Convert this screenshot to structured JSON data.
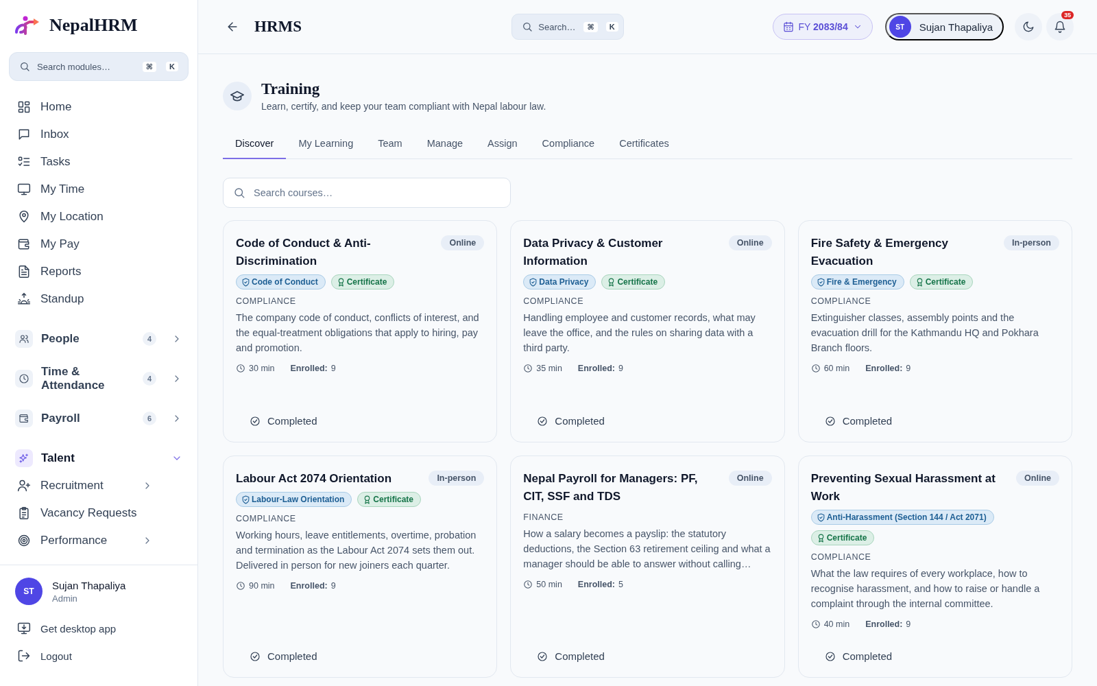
{
  "brand": {
    "name": "NepalHRM"
  },
  "sidebar": {
    "search": {
      "placeholder": "Search modules…",
      "keys": [
        "⌘",
        "K"
      ]
    },
    "items": [
      {
        "label": "Home"
      },
      {
        "label": "Inbox"
      },
      {
        "label": "Tasks"
      },
      {
        "label": "My Time"
      },
      {
        "label": "My Location"
      },
      {
        "label": "My Pay"
      },
      {
        "label": "Reports"
      },
      {
        "label": "Standup"
      }
    ],
    "groups": [
      {
        "label": "People",
        "count": "4",
        "expanded": false
      },
      {
        "label": "Time & Attendance",
        "count": "4",
        "expanded": false
      },
      {
        "label": "Payroll",
        "count": "6",
        "expanded": false
      },
      {
        "label": "Talent",
        "expanded": true,
        "children": [
          {
            "label": "Recruitment",
            "expanded": false
          },
          {
            "label": "Vacancy Requests"
          },
          {
            "label": "Performance",
            "expanded": false
          }
        ]
      }
    ],
    "user": {
      "initials": "ST",
      "name": "Sujan Thapaliya",
      "role": "Admin"
    },
    "footer": [
      {
        "label": "Get desktop app"
      },
      {
        "label": "Logout"
      }
    ]
  },
  "header": {
    "title": "HRMS",
    "search": {
      "placeholder": "Search…",
      "keys": [
        "⌘",
        "K"
      ]
    },
    "fiscal_year": {
      "prefix": "FY",
      "value": "2083/84"
    },
    "user": {
      "initials": "ST",
      "name": "Sujan Thapaliya"
    },
    "notifications": "35"
  },
  "page": {
    "title": "Training",
    "subtitle": "Learn, certify, and keep your team compliant with Nepal labour law."
  },
  "tabs": [
    {
      "label": "Discover",
      "selected": true
    },
    {
      "label": "My Learning",
      "selected": false
    },
    {
      "label": "Team",
      "selected": false
    },
    {
      "label": "Manage",
      "selected": false
    },
    {
      "label": "Assign",
      "selected": false
    },
    {
      "label": "Compliance",
      "selected": false
    },
    {
      "label": "Certificates",
      "selected": false
    }
  ],
  "course_search": {
    "placeholder": "Search courses…"
  },
  "courses": [
    {
      "title": "Code of Conduct & Anti-Discrimination",
      "mode": "Online",
      "tags": [
        {
          "kind": "topic",
          "label": "Code of Conduct"
        },
        {
          "kind": "certificate",
          "label": "Certificate"
        }
      ],
      "category": "COMPLIANCE",
      "description": "The company code of conduct, conflicts of interest, and the equal-treatment obligations that apply to hiring, pay and promotion.",
      "duration": "30 min",
      "enrolled_label": "Enrolled:",
      "enrolled": "9",
      "status": "Completed"
    },
    {
      "title": "Data Privacy & Customer Information",
      "mode": "Online",
      "tags": [
        {
          "kind": "topic",
          "label": "Data Privacy"
        },
        {
          "kind": "certificate",
          "label": "Certificate"
        }
      ],
      "category": "COMPLIANCE",
      "description": "Handling employee and customer records, what may leave the office, and the rules on sharing data with a third party.",
      "duration": "35 min",
      "enrolled_label": "Enrolled:",
      "enrolled": "9",
      "status": "Completed"
    },
    {
      "title": "Fire Safety & Emergency Evacuation",
      "mode": "In-person",
      "tags": [
        {
          "kind": "topic",
          "label": "Fire & Emergency"
        },
        {
          "kind": "certificate",
          "label": "Certificate"
        }
      ],
      "category": "COMPLIANCE",
      "description": "Extinguisher classes, assembly points and the evacuation drill for the Kathmandu HQ and Pokhara Branch floors.",
      "duration": "60 min",
      "enrolled_label": "Enrolled:",
      "enrolled": "9",
      "status": "Completed"
    },
    {
      "title": "Labour Act 2074 Orientation",
      "mode": "In-person",
      "tags": [
        {
          "kind": "topic",
          "label": "Labour-Law Orientation"
        },
        {
          "kind": "certificate",
          "label": "Certificate"
        }
      ],
      "category": "COMPLIANCE",
      "description": "Working hours, leave entitlements, overtime, probation and termination as the Labour Act 2074 sets them out. Delivered in person for new joiners each quarter.",
      "duration": "90 min",
      "enrolled_label": "Enrolled:",
      "enrolled": "9",
      "status": "Completed"
    },
    {
      "title": "Nepal Payroll for Managers: PF, CIT, SSF and TDS",
      "mode": "Online",
      "category": "FINANCE",
      "description": "How a salary becomes a payslip: the statutory deductions, the Section 63 retirement ceiling and what a manager should be able to answer without calling…",
      "duration": "50 min",
      "enrolled_label": "Enrolled:",
      "enrolled": "5",
      "status": "Completed"
    },
    {
      "title": "Preventing Sexual Harassment at Work",
      "mode": "Online",
      "tags": [
        {
          "kind": "topic",
          "label": "Anti-Harassment (Section 144 / Act 2071)"
        },
        {
          "kind": "certificate",
          "label": "Certificate"
        }
      ],
      "category": "COMPLIANCE",
      "description": "What the law requires of every workplace, how to recognise harassment, and how to raise or handle a complaint through the internal committee.",
      "duration": "40 min",
      "enrolled_label": "Enrolled:",
      "enrolled": "9",
      "status": "Completed"
    }
  ]
}
